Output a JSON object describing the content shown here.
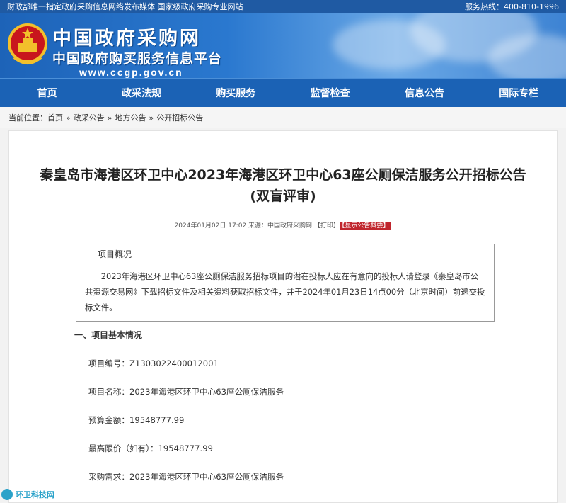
{
  "topbar": {
    "left": "财政部唯一指定政府采购信息网络发布媒体  国家级政府采购专业网站",
    "hotline": "服务热线：400-810-1996"
  },
  "header": {
    "title": "中国政府采购网",
    "subtitle": "中国政府购买服务信息平台",
    "url": "www.ccgp.gov.cn"
  },
  "nav": [
    "首页",
    "政采法规",
    "购买服务",
    "监督检查",
    "信息公告",
    "国际专栏"
  ],
  "breadcrumb": {
    "prefix": "当前位置：",
    "items": [
      "首页",
      "政采公告",
      "地方公告",
      "公开招标公告"
    ]
  },
  "article": {
    "title_line1": "秦皇岛市海港区环卫中心2023年海港区环卫中心63座公厕保洁服务公开招标公告",
    "title_line2": "(双盲评审)",
    "meta": "2024年01月02日 17:02 来源：中国政府采购网 【打印】",
    "summary_toggle": "【显示公告概要】",
    "summary": {
      "head": "项目概况",
      "body": "2023年海港区环卫中心63座公厕保洁服务招标项目的潜在投标人应在有意向的投标人请登录《秦皇岛市公共资源交易网》下载招标文件及相关资料获取招标文件，并于2024年01月23日14点00分（北京时间）前递交投标文件。"
    },
    "section_1": "一、项目基本情况",
    "fields": [
      "项目编号：Z1303022400012001",
      "项目名称：2023年海港区环卫中心63座公厕保洁服务",
      "预算金额：19548777.99",
      "最高限价（如有）：19548777.99",
      "采购需求：2023年海港区环卫中心63座公厕保洁服务"
    ]
  },
  "watermark": "环卫科技网",
  "colors": {
    "nav": "#1b62b5",
    "topbar": "#1f5aa3",
    "badge": "#c0262d"
  }
}
